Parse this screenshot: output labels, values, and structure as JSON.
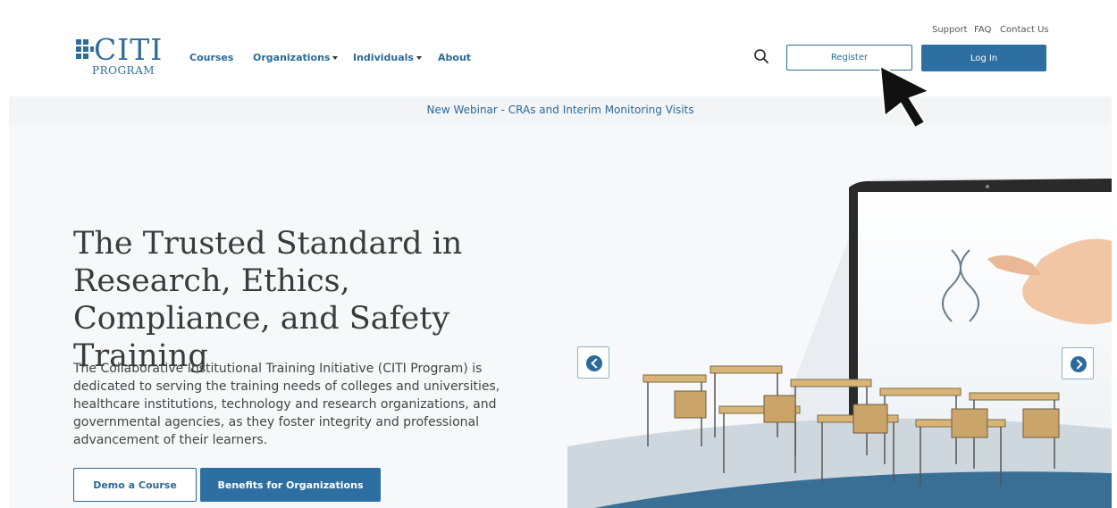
{
  "header": {
    "logo": {
      "brand": "CITI",
      "sub": "PROGRAM"
    },
    "nav": [
      {
        "label": "Courses"
      },
      {
        "label": "Organizations"
      },
      {
        "label": "Individuals"
      },
      {
        "label": "About"
      }
    ],
    "util_links": [
      "Support",
      "FAQ",
      "Contact Us"
    ],
    "register_label": "Register",
    "login_label": "Log In",
    "search_icon": "search-icon"
  },
  "banner": {
    "text": "New Webinar - CRAs and Interim Monitoring Visits"
  },
  "hero": {
    "title": "The Trusted Standard in Research, Ethics, Compliance, and Safety Training",
    "description": "The Collaborative Institutional Training Initiative (CITI Program) is dedicated to serving the training needs of colleges and universities, healthcare institutions, technology and research organizations, and governmental agencies, as they foster integrity and professional advancement of their learners.",
    "demo_label": "Demo a Course",
    "benefits_label": "Benefits for Organizations",
    "prev_icon": "chevron-left-icon",
    "next_icon": "chevron-right-icon"
  },
  "colors": {
    "brand": "#2b6a9a",
    "button": "#2e6fa1",
    "banner_bg": "#f3f4f5"
  }
}
